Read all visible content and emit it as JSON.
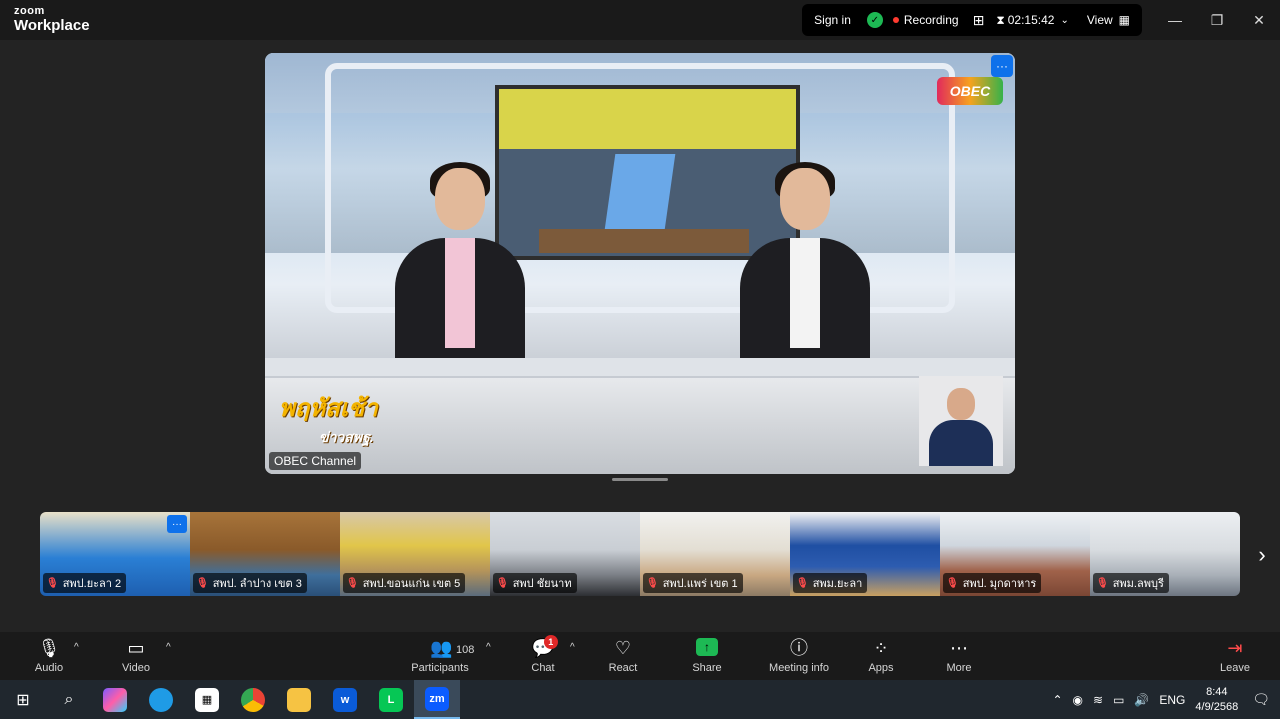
{
  "titlebar": {
    "brand_top": "zoom",
    "brand_bottom": "Workplace",
    "sign_in": "Sign in",
    "recording": "Recording",
    "timer": "02:15:42",
    "view": "View",
    "icons": [
      "shield-check-icon",
      "grid-icon",
      "hourglass-icon",
      "chevron-down-icon",
      "view-grid-icon",
      "minimize-icon",
      "restore-icon",
      "close-icon"
    ]
  },
  "main_video": {
    "name": "OBEC Channel",
    "channel_logo": "OBEC",
    "show_title": "พฤหัสเช้า",
    "show_subtitle": "ข่าวสพฐ."
  },
  "gallery": [
    {
      "name": "สพป.ยะลา 2"
    },
    {
      "name": "สพป. ลำปาง เขต 3"
    },
    {
      "name": "สพป.ขอนแก่น เขต 5"
    },
    {
      "name": "สพป ชัยนาท"
    },
    {
      "name": "สพป.แพร่ เขต 1"
    },
    {
      "name": "สพม.ยะลา"
    },
    {
      "name": "สพป. มุกดาหาร"
    },
    {
      "name": "สพม.ลพบุรี"
    }
  ],
  "toolbar": {
    "audio": "Audio",
    "video": "Video",
    "participants": "Participants",
    "participants_count": "108",
    "chat": "Chat",
    "chat_badge": "1",
    "react": "React",
    "share": "Share",
    "meeting_info": "Meeting info",
    "apps": "Apps",
    "more": "More",
    "leave": "Leave"
  },
  "taskbar": {
    "language": "ENG",
    "time": "8:44",
    "date": "4/9/2568",
    "zoom_label": "zm"
  },
  "colors": {
    "accent_blue": "#0e71eb",
    "recording_red": "#ff3b30",
    "share_green": "#1db954"
  }
}
